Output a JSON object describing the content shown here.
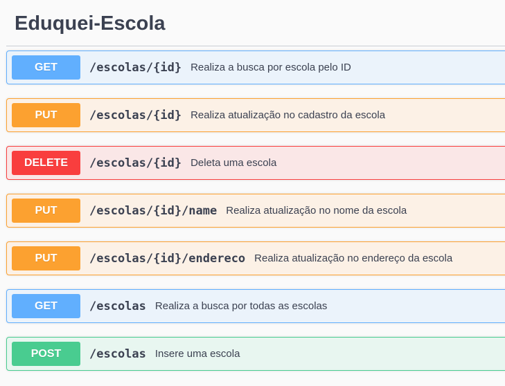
{
  "title": "Eduquei-Escola",
  "operations": [
    {
      "method": "GET",
      "path": "/escolas/{id}",
      "summary": "Realiza a busca por escola pelo ID"
    },
    {
      "method": "PUT",
      "path": "/escolas/{id}",
      "summary": "Realiza atualização no cadastro da escola"
    },
    {
      "method": "DELETE",
      "path": "/escolas/{id}",
      "summary": "Deleta uma escola"
    },
    {
      "method": "PUT",
      "path": "/escolas/{id}/name",
      "summary": "Realiza atualização no nome da escola"
    },
    {
      "method": "PUT",
      "path": "/escolas/{id}/endereco",
      "summary": "Realiza atualização no endereço da escola"
    },
    {
      "method": "GET",
      "path": "/escolas",
      "summary": "Realiza a busca por todas as escolas"
    },
    {
      "method": "POST",
      "path": "/escolas",
      "summary": "Insere uma escola"
    }
  ],
  "colors": {
    "get": "#61affe",
    "put": "#fca130",
    "delete": "#f93e3e",
    "post": "#49cc90",
    "text": "#3b4151"
  }
}
